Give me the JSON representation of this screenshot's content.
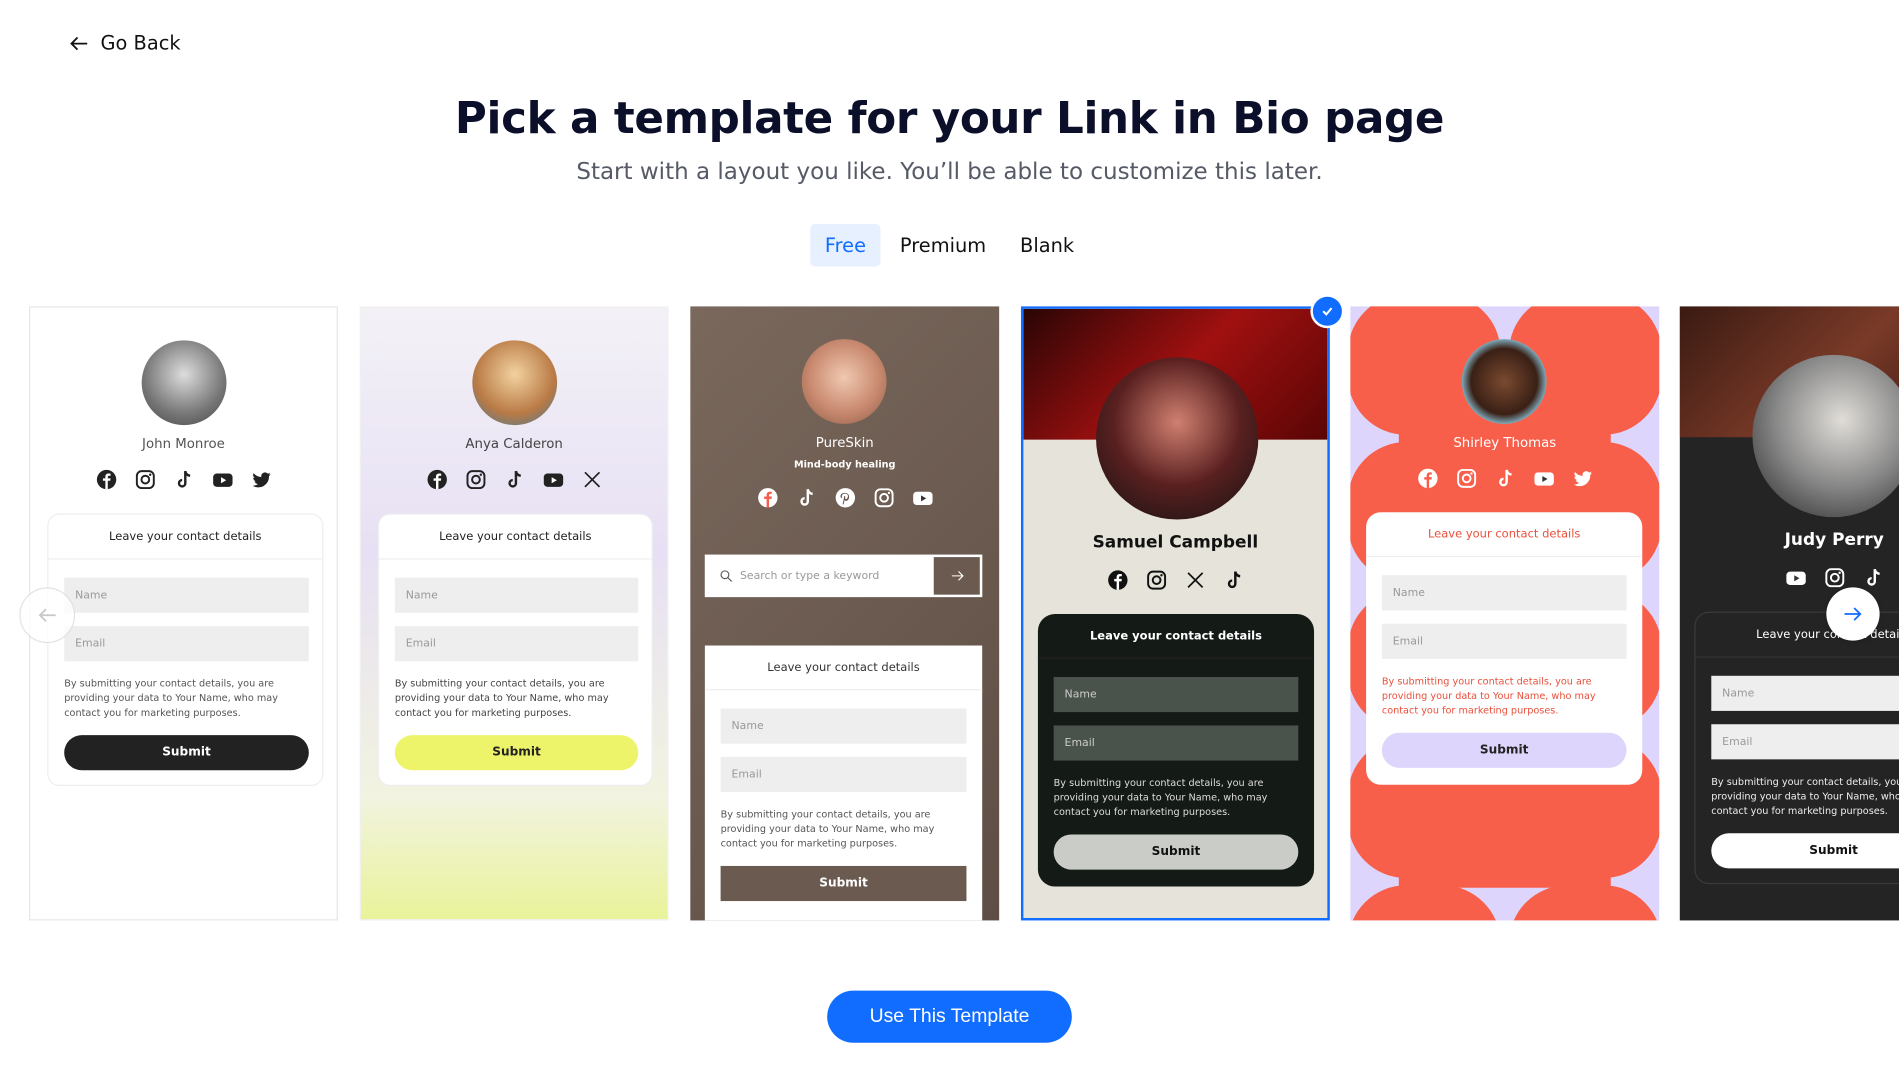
{
  "header": {
    "go_back": "Go Back",
    "title": "Pick a template for your Link in Bio page",
    "subtitle": "Start with a layout you like. You’ll be able to customize this later."
  },
  "tabs": [
    {
      "label": "Free",
      "active": true
    },
    {
      "label": "Premium",
      "active": false
    },
    {
      "label": "Blank",
      "active": false
    }
  ],
  "selected_template_index": 3,
  "accent_color": "#116dff",
  "templates": [
    {
      "name": "John Monroe",
      "socials": [
        "facebook",
        "instagram",
        "tiktok",
        "youtube",
        "twitter"
      ],
      "form": {
        "header": "Leave your contact details",
        "name_placeholder": "Name",
        "email_placeholder": "Email",
        "disclaimer": "By submitting your contact details, you are providing your data to Your Name, who may contact you for marketing purposes.",
        "submit": "Submit"
      }
    },
    {
      "name": "Anya Calderon",
      "socials": [
        "facebook",
        "instagram",
        "tiktok",
        "youtube",
        "x"
      ],
      "form": {
        "header": "Leave your contact details",
        "name_placeholder": "Name",
        "email_placeholder": "Email",
        "disclaimer": "By submitting your contact details, you are providing your data to Your Name, who may contact you for marketing purposes.",
        "submit": "Submit"
      }
    },
    {
      "name": "PureSkin",
      "tagline": "Mind-body healing",
      "socials": [
        "facebook",
        "tiktok",
        "pinterest",
        "instagram",
        "youtube"
      ],
      "search_placeholder": "Search or type a keyword",
      "form": {
        "header": "Leave your contact details",
        "name_placeholder": "Name",
        "email_placeholder": "Email",
        "disclaimer": "By submitting your contact details, you are providing your data to Your Name, who may contact you for marketing purposes.",
        "submit": "Submit"
      }
    },
    {
      "name": "Samuel Campbell",
      "socials": [
        "facebook",
        "instagram",
        "x",
        "tiktok"
      ],
      "form": {
        "header": "Leave your contact details",
        "name_placeholder": "Name",
        "email_placeholder": "Email",
        "disclaimer": "By submitting your contact details, you are providing your data to Your Name, who may contact you for marketing purposes.",
        "submit": "Submit"
      }
    },
    {
      "name": "Shirley Thomas",
      "socials": [
        "facebook",
        "instagram",
        "tiktok",
        "youtube",
        "twitter"
      ],
      "form": {
        "header": "Leave your contact details",
        "name_placeholder": "Name",
        "email_placeholder": "Email",
        "disclaimer": "By submitting your contact details, you are providing your data to Your Name, who may contact you for marketing purposes.",
        "submit": "Submit"
      }
    },
    {
      "name": "Judy Perry",
      "socials": [
        "youtube",
        "instagram",
        "tiktok"
      ],
      "form": {
        "header": "Leave your contact details",
        "name_placeholder": "Name",
        "email_placeholder": "Email",
        "disclaimer": "By submitting your contact details, you are providing your data to Your Name, who may contact you for marketing purposes.",
        "submit": "Submit"
      }
    }
  ],
  "carousel": {
    "prev_icon": "arrow-left-icon",
    "next_icon": "arrow-right-icon"
  },
  "cta": {
    "label": "Use This Template"
  }
}
